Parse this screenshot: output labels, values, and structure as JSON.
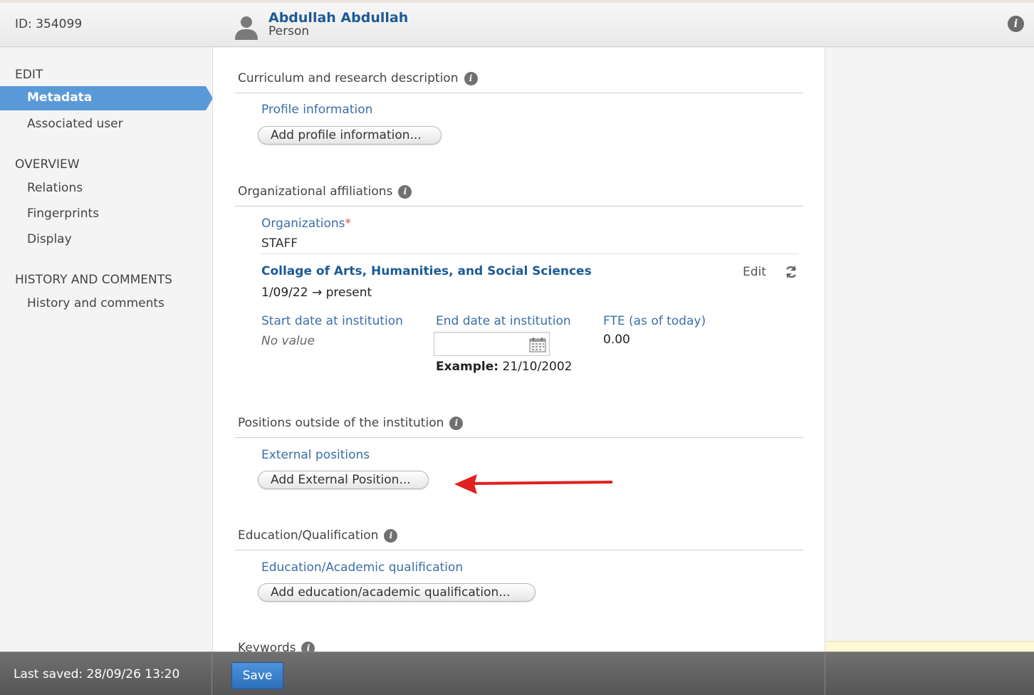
{
  "header": {
    "id_text": "ID: 354099",
    "person_name": "Abdullah Abdullah",
    "person_type": "Person",
    "info_glyph": "i"
  },
  "sidebar": {
    "edit_heading": "EDIT",
    "edit_items": [
      "Metadata",
      "Associated user"
    ],
    "overview_heading": "OVERVIEW",
    "overview_items": [
      "Relations",
      "Fingerprints",
      "Display"
    ],
    "history_heading": "HISTORY AND COMMENTS",
    "history_items": [
      "History and comments"
    ],
    "active_item": "Metadata"
  },
  "sections": {
    "curriculum": {
      "title": "Curriculum and research description",
      "field_label": "Profile information",
      "button": "Add profile information..."
    },
    "affiliations": {
      "title": "Organizational affiliations",
      "field_label": "Organizations",
      "required_mark": "*",
      "group": "STAFF",
      "organization": "Collage of Arts,  Humanities, and Social Sciences",
      "period": "1/09/22 → present",
      "edit_label": "Edit",
      "start_label": "Start date at institution",
      "start_value": "No value",
      "end_label": "End date at institution",
      "end_value": "",
      "example_label": "Example:",
      "example_value": " 21/10/2002",
      "fte_label": "FTE (as of today)",
      "fte_value": "0.00"
    },
    "positions": {
      "title": "Positions outside of the institution",
      "field_label": "External positions",
      "button": "Add External Position..."
    },
    "education": {
      "title": "Education/Qualification",
      "field_label": "Education/Academic qualification",
      "button": "Add education/academic qualification..."
    },
    "keywords": {
      "title": "Keywords"
    }
  },
  "footer": {
    "last_saved": "Last saved: 28/09/26 13:20",
    "save_label": "Save"
  },
  "colors": {
    "accent": "#5a99d8",
    "link": "#1c5a96",
    "label": "#3a6ea8",
    "annotation_arrow": "#e02020"
  }
}
